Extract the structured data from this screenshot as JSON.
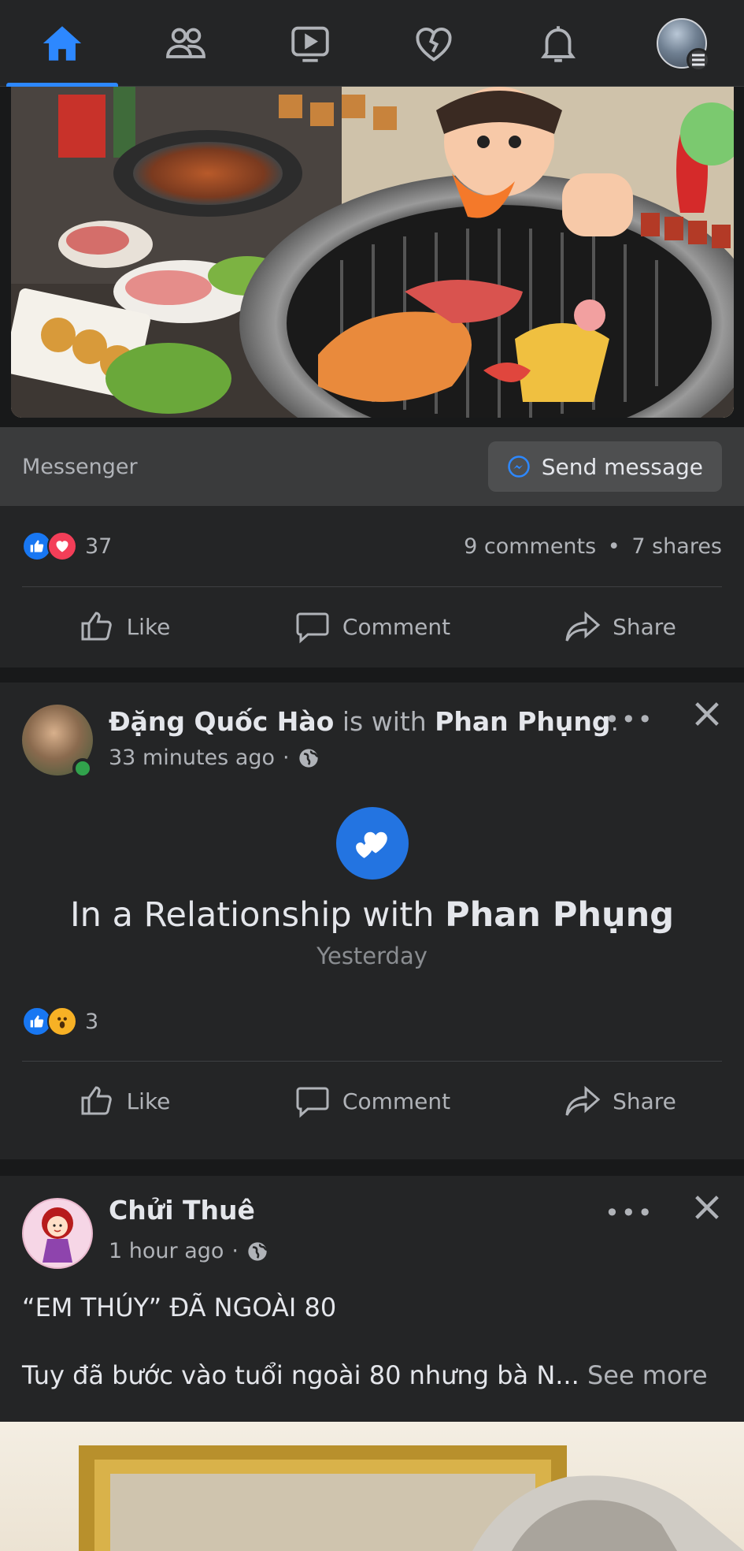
{
  "nav": {
    "tabs": [
      {
        "name": "home",
        "icon": "home-icon",
        "active": true
      },
      {
        "name": "friends",
        "icon": "friends-icon"
      },
      {
        "name": "watch",
        "icon": "video-icon"
      },
      {
        "name": "dating",
        "icon": "heart-icon"
      },
      {
        "name": "notifications",
        "icon": "bell-icon"
      },
      {
        "name": "menu",
        "icon": "profile-menu-icon"
      }
    ]
  },
  "ad_post": {
    "cta_source": "Messenger",
    "cta_button": "Send message",
    "reaction_count": "37",
    "comments": "9 comments",
    "separator": "•",
    "shares": "7 shares"
  },
  "actions": {
    "like": "Like",
    "comment": "Comment",
    "share": "Share"
  },
  "post2": {
    "author": "Đặng Quốc Hào",
    "connector": "is with",
    "tagged": "Phan Phụng",
    "time": "33 minutes ago",
    "dot": "·",
    "event_prefix": "In a Relationship with",
    "event_name": "Phan Phụng",
    "event_date": "Yesterday",
    "reaction_count": "3"
  },
  "post3": {
    "author": "Chửi Thuê",
    "time": "1 hour ago",
    "dot": "·",
    "headline": "“EM THÚY” ĐÃ NGOÀI 80",
    "excerpt": "Tuy đã bước vào tuổi ngoài 80 nhưng bà N...",
    "see_more": "See more"
  },
  "colors": {
    "accent": "#2d88ff",
    "background": "#18191a",
    "card": "#242526",
    "like_blue": "#1877f2",
    "love_red": "#f33e58",
    "online_green": "#31a24c"
  }
}
